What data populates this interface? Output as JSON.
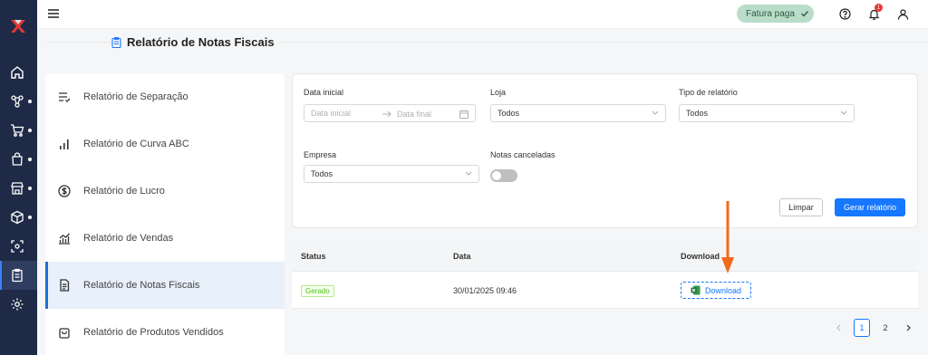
{
  "topbar": {
    "invoice_status": "Fatura paga",
    "notifications_count": "1"
  },
  "page": {
    "title": "Relatório de Notas Fiscais"
  },
  "sidebar": {
    "items": [
      {
        "icon": "home-icon"
      },
      {
        "icon": "network-icon",
        "expandable": true
      },
      {
        "icon": "cart-icon",
        "expandable": true
      },
      {
        "icon": "shopping-bag-icon",
        "expandable": true
      },
      {
        "icon": "store-icon",
        "expandable": true
      },
      {
        "icon": "box-icon",
        "expandable": true
      },
      {
        "icon": "scan-icon"
      },
      {
        "icon": "report-icon",
        "active": true
      },
      {
        "icon": "settings-icon"
      }
    ]
  },
  "reports_menu": {
    "items": [
      {
        "label": "Relatório de Separação",
        "icon": "checklist-icon"
      },
      {
        "label": "Relatório de Curva ABC",
        "icon": "bar-chart-icon"
      },
      {
        "label": "Relatório de Lucro",
        "icon": "dollar-circle-icon"
      },
      {
        "label": "Relatório de Vendas",
        "icon": "sales-chart-icon"
      },
      {
        "label": "Relatório de Notas Fiscais",
        "icon": "invoice-icon",
        "active": true
      },
      {
        "label": "Relatório de Produtos Vendidos",
        "icon": "bag-icon"
      }
    ]
  },
  "filters": {
    "start_date_label": "Data inicial",
    "start_date_placeholder": "Data inicial",
    "end_date_placeholder": "Data final",
    "store_label": "Loja",
    "store_value": "Todos",
    "report_type_label": "Tipo de relatório",
    "report_type_value": "Todos",
    "company_label": "Empresa",
    "company_value": "Todos",
    "canceled_label": "Notas canceladas",
    "canceled_enabled": false,
    "clear_button": "Limpar",
    "generate_button": "Gerar relatório"
  },
  "table": {
    "headers": [
      "Status",
      "Data",
      "Download"
    ],
    "rows": [
      {
        "status": "Gerado",
        "date": "30/01/2025 09:46",
        "download": "Download"
      }
    ]
  },
  "pagination": {
    "pages": [
      "1",
      "2"
    ],
    "current": "1"
  },
  "colors": {
    "sidebar_bg": "#1e2a46",
    "accent": "#1677ff",
    "annotation_arrow": "#f26a1b",
    "success": "#52c41a"
  }
}
